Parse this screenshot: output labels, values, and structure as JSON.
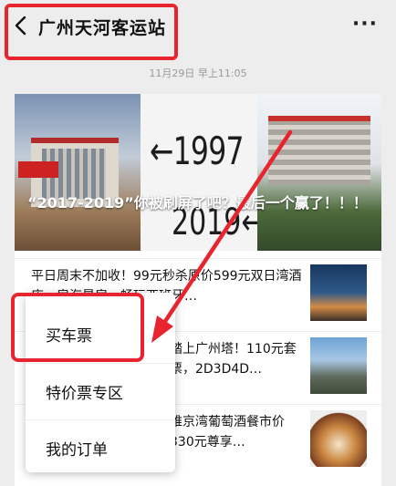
{
  "header": {
    "back_icon": "chevron-left-icon",
    "title": "广州天河客运站",
    "more_label": "···",
    "more_icon": "more-icon"
  },
  "timestamp": "11月29日 早上11:05",
  "hero": {
    "caption": "“2017-2019”你被刷屏了吧？最后一个赢了！！！",
    "year_top": "←1997",
    "year_bottom": "2019←"
  },
  "articles": [
    {
      "text": "平日周末不加收！99元秒杀原价599元双日湾酒店一房海景房，畅玩西班牙…"
    },
    {
      "text": "踏上广州塔！110元套票，2D3D4D…"
    },
    {
      "text": "维京湾葡萄酒餐市价330元尊享…"
    }
  ],
  "menu": {
    "items": [
      "买车票",
      "特价票专区",
      "我的订单"
    ]
  },
  "colors": {
    "annotation": "#e8242e",
    "background": "#ededed"
  }
}
